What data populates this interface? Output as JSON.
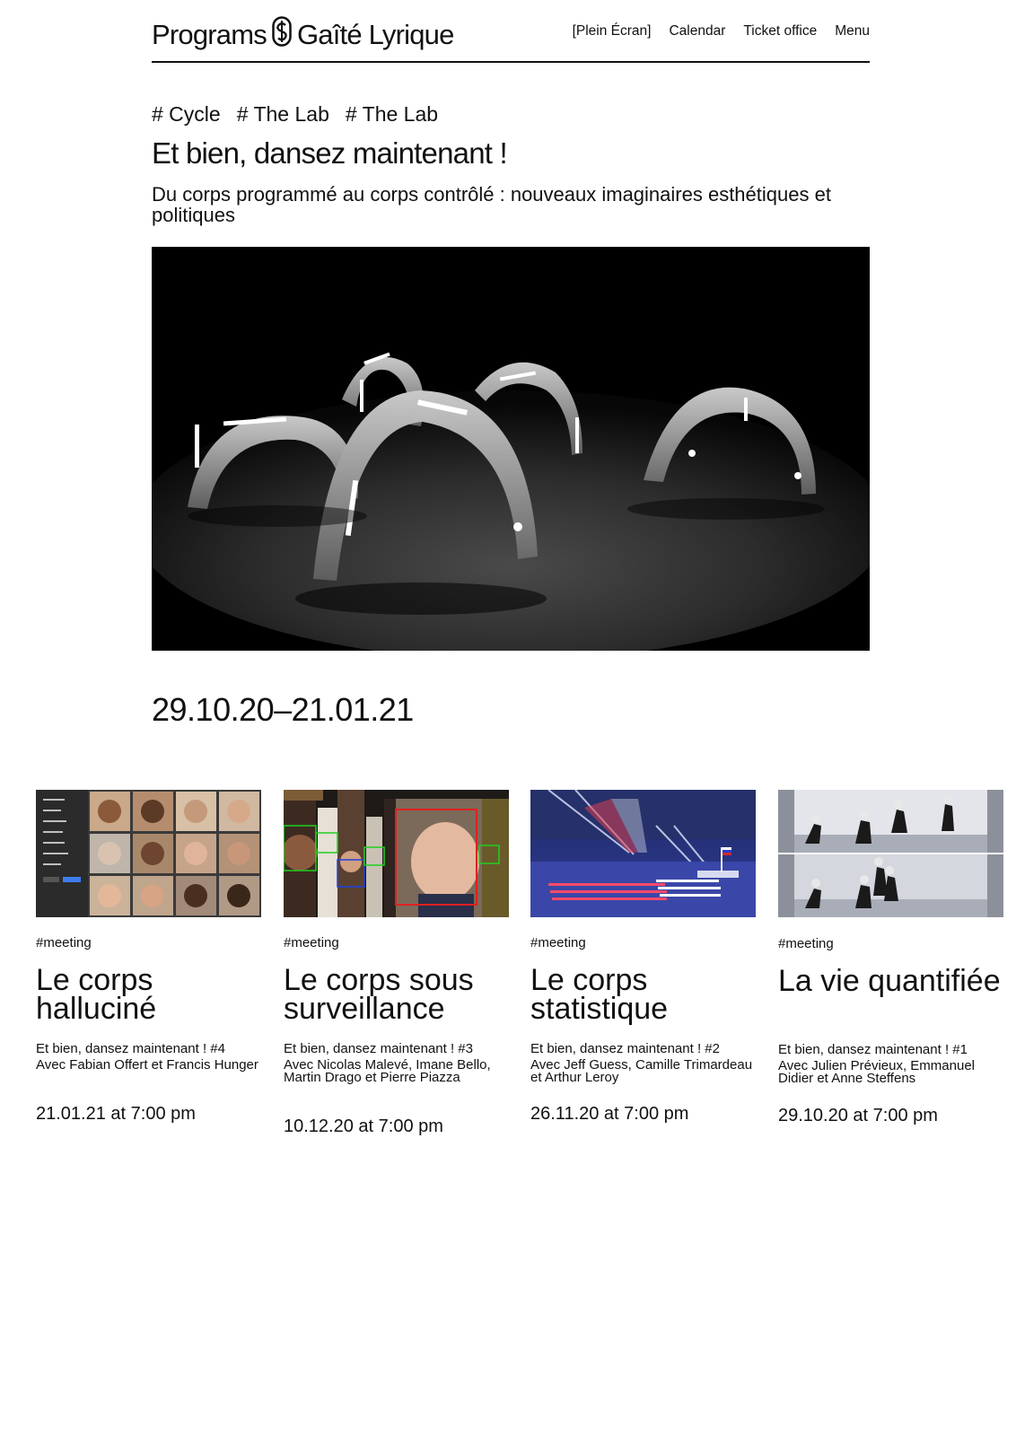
{
  "header": {
    "logo_text_left": "Programs",
    "logo_text_right": "Gaîté Lyrique",
    "nav": [
      "[Plein Écran]",
      "Calendar",
      "Ticket office",
      "Menu"
    ]
  },
  "cycle": {
    "tags": [
      "# Cycle",
      "# The Lab",
      "# The Lab"
    ],
    "title": "Et bien, dansez maintenant !",
    "subtitle": "Du corps programmé au corps contrôlé : nouveaux imaginaires esthétiques et politiques",
    "dates": "29.10.20–21.01.21"
  },
  "events": [
    {
      "tag": "#meeting",
      "title": "Le corps halluciné",
      "series": "Et bien, dansez maintenant ! #4",
      "guests": "Avec Fabian Offert et Francis Hunger",
      "date": "21.01.21 at 7:00 pm"
    },
    {
      "tag": "#meeting",
      "title": "Le corps sous surveillance",
      "series": "Et bien, dansez maintenant ! #3",
      "guests": "Avec Nicolas Malevé, Imane Bello, Martin Drago et Pierre Piazza",
      "date": "10.12.20 at 7:00 pm"
    },
    {
      "tag": "#meeting",
      "title": "Le corps statistique",
      "series": "Et bien, dansez maintenant ! #2",
      "guests": "Avec Jeff Guess, Camille Trimardeau et Arthur Leroy",
      "date": "26.11.20 at 7:00 pm"
    },
    {
      "tag": "#meeting",
      "title": "La vie quantifiée",
      "series": "Et bien, dansez maintenant ! #1",
      "guests": "Avec Julien Prévieux, Emmanuel Didier et Anne Steffens",
      "date": "29.10.20 at 7:00 pm"
    }
  ]
}
